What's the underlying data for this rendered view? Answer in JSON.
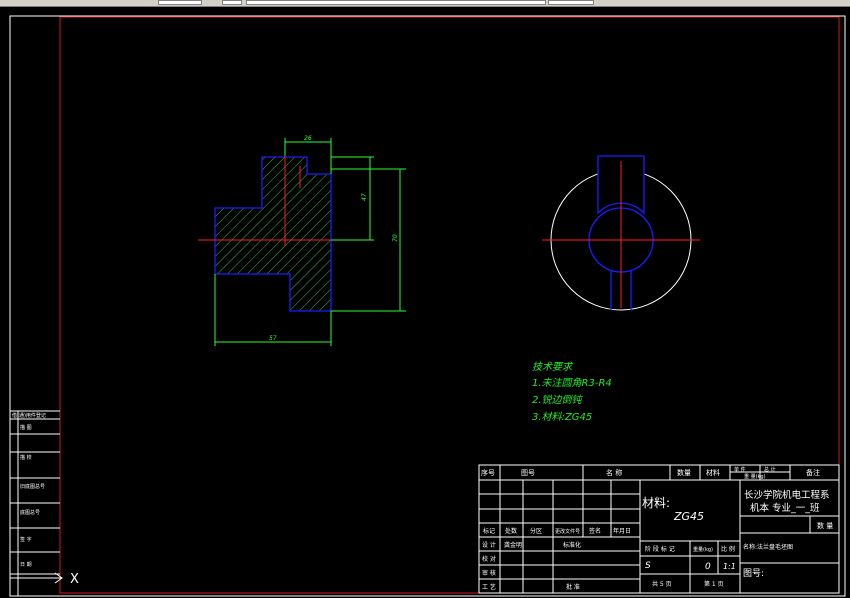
{
  "toolbar": {
    "visible": true
  },
  "colors": {
    "frame": "#d01818",
    "part_outline": "#1c1cff",
    "hatch": "#28c828",
    "dimension": "#2aff2a",
    "center_line": "#ff2020",
    "title_block_lines": "#ffffff",
    "background": "#000000"
  },
  "drawing": {
    "dimensions": {
      "top_width": "26",
      "right_small": "47",
      "right_large": "70",
      "bottom_width": "57"
    },
    "tech_requirements": {
      "title": "技术要求",
      "items": [
        "1.未注圆角R3-R4",
        "2.锐边倒钝",
        "3.材料:ZG45"
      ]
    }
  },
  "left_strip": {
    "labels": [
      "借(通)用件登记",
      "描 图",
      "描 校",
      "旧底图总号",
      "底图总号",
      "签 字",
      "日 期"
    ]
  },
  "title_block": {
    "header": {
      "seq": "序号",
      "drawing_no": "图号",
      "name": "名 称",
      "qty": "数量",
      "material": "材料",
      "single": "单 件",
      "total": "总 计",
      "weight": "重 量(kg)",
      "remark": "备注"
    },
    "material_label": "材料:",
    "material_value": "ZG45",
    "school_line1": "长沙学院机电工程系",
    "school_line2": "机本 专业_一_班",
    "qty_label": "数 量",
    "part_name": "名称:法兰盘毛坯图",
    "drawing_number_label": "图号:",
    "change_row": [
      "标记",
      "处数",
      "分区",
      "更改文件号",
      "签名",
      "年月日"
    ],
    "sign_rows": [
      "设 计",
      "校 对",
      "审 核",
      "工 艺"
    ],
    "sign_name": "龚金明",
    "standardize": "标准化",
    "approve": "批 准",
    "stage_label": "阶 段 标 记",
    "weight_label": "重量(kg)",
    "scale_label": "比 例",
    "stage_value": "S",
    "weight_value": "0",
    "scale_value": "1:1",
    "sheets_total": "共 5 页",
    "sheet_current": "第 1 页"
  },
  "ucs": {
    "x_label": "X"
  }
}
